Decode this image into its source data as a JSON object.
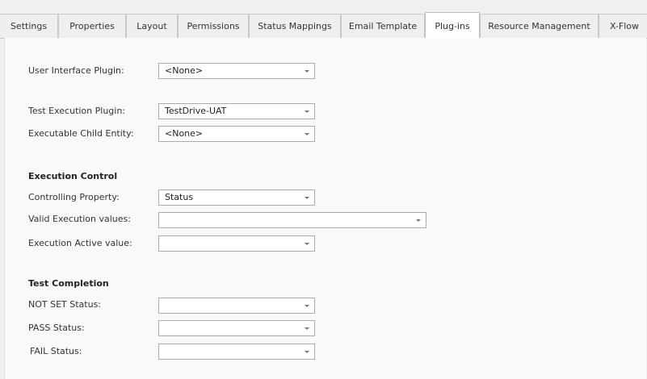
{
  "tabs": [
    {
      "label": "Settings"
    },
    {
      "label": "Properties"
    },
    {
      "label": "Layout"
    },
    {
      "label": "Permissions"
    },
    {
      "label": "Status Mappings"
    },
    {
      "label": "Email Template"
    },
    {
      "label": "Plug-ins",
      "active": true
    },
    {
      "label": "Resource Management"
    },
    {
      "label": "X-Flow"
    }
  ],
  "plugins": {
    "ui_plugin_label": "User Interface Plugin:",
    "ui_plugin_value": "<None>",
    "test_exec_plugin_label": "Test Execution Plugin:",
    "test_exec_plugin_value": "TestDrive-UAT",
    "child_entity_label": "Executable Child Entity:",
    "child_entity_value": "<None>"
  },
  "execution_control": {
    "heading": "Execution Control",
    "controlling_property_label": "Controlling Property:",
    "controlling_property_value": "Status",
    "valid_values_label": "Valid Execution values:",
    "valid_values_value": "",
    "active_value_label": "Execution Active value:",
    "active_value_value": ""
  },
  "test_completion": {
    "heading": "Test Completion",
    "not_set_label": "NOT SET Status:",
    "not_set_value": "",
    "pass_label": "PASS Status:",
    "pass_value": "",
    "fail_label": "FAIL Status:",
    "fail_value": ""
  }
}
